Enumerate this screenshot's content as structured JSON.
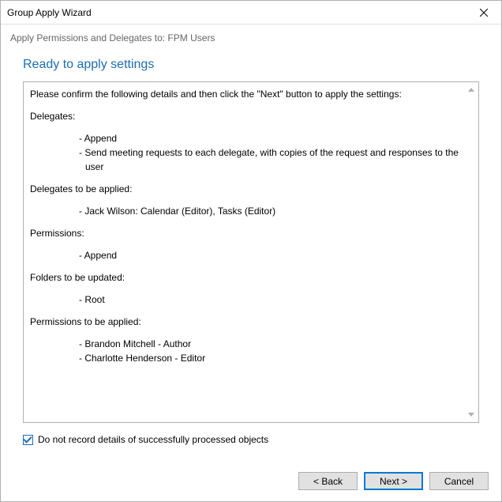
{
  "window": {
    "title": "Group Apply Wizard"
  },
  "subtitle": "Apply Permissions and Delegates to: FPM Users",
  "heading": "Ready to apply settings",
  "details": {
    "intro": "Please confirm the following details and then click the \"Next\" button to apply the settings:",
    "delegates_label": "Delegates:",
    "delegates_line1": "- Append",
    "delegates_line2": "- Send meeting requests to each delegate, with copies of the request and responses to the user",
    "delegates_applied_label": "Delegates to be applied:",
    "delegates_applied_line1": "- Jack Wilson: Calendar (Editor), Tasks (Editor)",
    "permissions_label": "Permissions:",
    "permissions_line1": "- Append",
    "folders_label": "Folders to be updated:",
    "folders_line1": "- Root",
    "perm_applied_label": "Permissions to be applied:",
    "perm_applied_line1": "- Brandon Mitchell - Author",
    "perm_applied_line2": "- Charlotte Henderson - Editor"
  },
  "checkbox": {
    "checked": true,
    "label": "Do not record details of successfully processed objects"
  },
  "buttons": {
    "back": "< Back",
    "next": "Next >",
    "cancel": "Cancel"
  }
}
